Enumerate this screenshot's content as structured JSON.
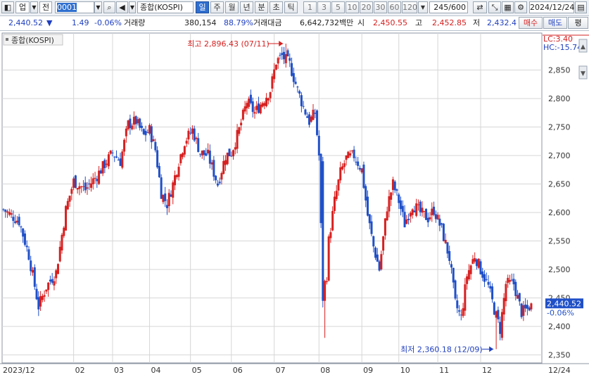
{
  "toolbar": {
    "market_label": "업",
    "prev_label": "전",
    "code_value": "0001",
    "index_name": "종합(KOSPI)",
    "period_buttons": [
      "일",
      "주",
      "월",
      "년",
      "분",
      "초",
      "틱"
    ],
    "active_period": "일",
    "interval_buttons": [
      "1",
      "3",
      "5",
      "10",
      "20",
      "30",
      "60",
      "120"
    ],
    "count": "245",
    "count_max": "/600",
    "date": "2024/12/24"
  },
  "info": {
    "price": "2,440.52",
    "change": "1.49",
    "change_pct": "-0.06%",
    "volume_label": "거래량",
    "volume": "380,154",
    "volume_ratio": "88.79%",
    "amount_label": "거래대금",
    "amount": "6,642,732백만",
    "open_label": "시",
    "open": "2,450.55",
    "high_label": "고",
    "high": "2,452.85",
    "low_label": "저",
    "low": "2,432.4",
    "buy_label": "매수",
    "sell_label": "매도",
    "eval_label": "평"
  },
  "chart_data": {
    "type": "candlestick",
    "title": "종합(KOSPI)",
    "lc_label": "LC:3.40",
    "hc_label": "HC:-15.74",
    "y_ticks": [
      2350,
      2400,
      2450,
      2500,
      2550,
      2600,
      2650,
      2700,
      2750,
      2800,
      2850
    ],
    "ylim": [
      2336,
      2915
    ],
    "x_ticks": [
      {
        "label": "2023/12",
        "idx": 0
      },
      {
        "label": "02",
        "idx": 36
      },
      {
        "label": "03",
        "idx": 56
      },
      {
        "label": "04",
        "idx": 75
      },
      {
        "label": "05",
        "idx": 96
      },
      {
        "label": "06",
        "idx": 117
      },
      {
        "label": "07",
        "idx": 139
      },
      {
        "label": "08",
        "idx": 162
      },
      {
        "label": "09",
        "idx": 184
      },
      {
        "label": "10",
        "idx": 203
      },
      {
        "label": "11",
        "idx": 223
      },
      {
        "label": "12",
        "idx": 245
      },
      {
        "label": "12/24",
        "idx": 275
      }
    ],
    "x_count": 276,
    "anchors": [
      [
        0,
        2605
      ],
      [
        8,
        2585
      ],
      [
        13,
        2525
      ],
      [
        18,
        2435
      ],
      [
        22,
        2470
      ],
      [
        27,
        2495
      ],
      [
        32,
        2605
      ],
      [
        36,
        2655
      ],
      [
        42,
        2640
      ],
      [
        48,
        2665
      ],
      [
        52,
        2685
      ],
      [
        56,
        2705
      ],
      [
        60,
        2690
      ],
      [
        64,
        2755
      ],
      [
        68,
        2760
      ],
      [
        72,
        2735
      ],
      [
        75,
        2745
      ],
      [
        78,
        2710
      ],
      [
        81,
        2635
      ],
      [
        84,
        2615
      ],
      [
        87,
        2650
      ],
      [
        90,
        2690
      ],
      [
        93,
        2725
      ],
      [
        97,
        2745
      ],
      [
        101,
        2705
      ],
      [
        105,
        2700
      ],
      [
        110,
        2650
      ],
      [
        114,
        2700
      ],
      [
        117,
        2705
      ],
      [
        121,
        2745
      ],
      [
        125,
        2795
      ],
      [
        129,
        2775
      ],
      [
        133,
        2795
      ],
      [
        137,
        2815
      ],
      [
        140,
        2865
      ],
      [
        143,
        2875
      ],
      [
        147,
        2860
      ],
      [
        151,
        2815
      ],
      [
        154,
        2785
      ],
      [
        157,
        2760
      ],
      [
        160,
        2775
      ],
      [
        162,
        2700
      ],
      [
        164,
        2450
      ],
      [
        165,
        2430
      ],
      [
        167,
        2550
      ],
      [
        170,
        2620
      ],
      [
        173,
        2670
      ],
      [
        176,
        2695
      ],
      [
        180,
        2700
      ],
      [
        184,
        2675
      ],
      [
        187,
        2595
      ],
      [
        190,
        2540
      ],
      [
        193,
        2500
      ],
      [
        197,
        2610
      ],
      [
        200,
        2650
      ],
      [
        203,
        2620
      ],
      [
        206,
        2580
      ],
      [
        210,
        2615
      ],
      [
        214,
        2600
      ],
      [
        218,
        2590
      ],
      [
        221,
        2605
      ],
      [
        225,
        2570
      ],
      [
        229,
        2520
      ],
      [
        232,
        2440
      ],
      [
        235,
        2415
      ],
      [
        238,
        2490
      ],
      [
        242,
        2525
      ],
      [
        245,
        2500
      ],
      [
        249,
        2470
      ],
      [
        252,
        2430
      ],
      [
        255,
        2395
      ],
      [
        258,
        2475
      ],
      [
        262,
        2475
      ],
      [
        266,
        2425
      ],
      [
        269,
        2430
      ],
      [
        271,
        2440
      ]
    ],
    "current_label": "2,440.52",
    "current_pct": "-0.06%",
    "current_value": 2440.52,
    "max_annotation": {
      "text": "최고 2,896.43 (07/11)",
      "value": 2896.43,
      "idx": 145
    },
    "min_annotation": {
      "text": "최저 2,360.18 (12/09)",
      "value": 2360.18,
      "idx": 253
    },
    "colors": {
      "up": "#d62020",
      "down": "#2050c8",
      "grid": "#d6d6d6"
    }
  }
}
